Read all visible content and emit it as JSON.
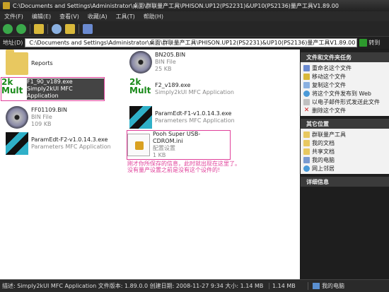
{
  "window": {
    "title": "C:\\Documents and Settings\\Administrator\\桌面\\群联量产工具\\PHISON.UP12(PS2231)&UP10(PS2136)量产工具V1.89.00"
  },
  "menu": [
    "文件(F)",
    "编辑(E)",
    "查看(V)",
    "收藏(A)",
    "工具(T)",
    "帮助(H)"
  ],
  "address": {
    "label": "地址(D)",
    "path": "C:\\Documents and Settings\\Administrator\\桌面\\群联量产工具\\PHISON.UP12(PS2231)&UP10(PS2136)量产工具V1.89.00",
    "go": "转到"
  },
  "files": [
    {
      "name": "Reports",
      "sub1": "",
      "sub2": "",
      "icon": "folder-icon"
    },
    {
      "name": "BN205.BIN",
      "sub1": "BIN File",
      "sub2": "25 KB",
      "icon": "disc-icon"
    },
    {
      "name": "F1_90_v189.exe",
      "sub1": "Simply2kUI MFC Application",
      "sub2": "",
      "icon": "2k-mult-icon"
    },
    {
      "name": "F2_v189.exe",
      "sub1": "Simply2kUI MFC Application",
      "sub2": "",
      "icon": "2k-mult-icon"
    },
    {
      "name": "FF01109.BIN",
      "sub1": "BIN File",
      "sub2": "109 KB",
      "icon": "disc-icon"
    },
    {
      "name": "ParamEdt-F1-v1.0.14.3.exe",
      "sub1": "Parameters MFC Application",
      "sub2": "",
      "icon": "cubes-icon"
    },
    {
      "name": "ParamEdt-F2-v1.0.14.3.exe",
      "sub1": "Parameters MFC Application",
      "sub2": "",
      "icon": "cubes-icon"
    },
    {
      "name": "Pooh Super USB-CDROM.ini",
      "sub1": "配置设置",
      "sub2": "1 KB",
      "icon": "ini-file-icon"
    }
  ],
  "note": "刚才你所保存的信息，此时就出现在这里了。没有量产设置之前是没有这个设件的!",
  "sidebar": {
    "tasks_title": "文件和文件夹任务",
    "tasks": [
      "重命名这个文件",
      "移动这个文件",
      "复制这个文件",
      "将这个文件发布到 Web",
      "以电子邮件形式发送此文件",
      "删除这个文件"
    ],
    "places_title": "其它位置",
    "places": [
      "群联量产工具",
      "我的文档",
      "共享文档",
      "我的电脑",
      "网上邻居"
    ],
    "details_title": "详细信息"
  },
  "status": {
    "main": "描述: Simply2kUI MFC Application 文件版本: 1.89.0.0 创建日期: 2008-11-27 9:34 大小: 1.14 MB",
    "size": "1.14 MB",
    "zone": "我的电脑"
  },
  "colors": {
    "highlight_box": "#e0409a",
    "note_text": "#e0409a"
  }
}
